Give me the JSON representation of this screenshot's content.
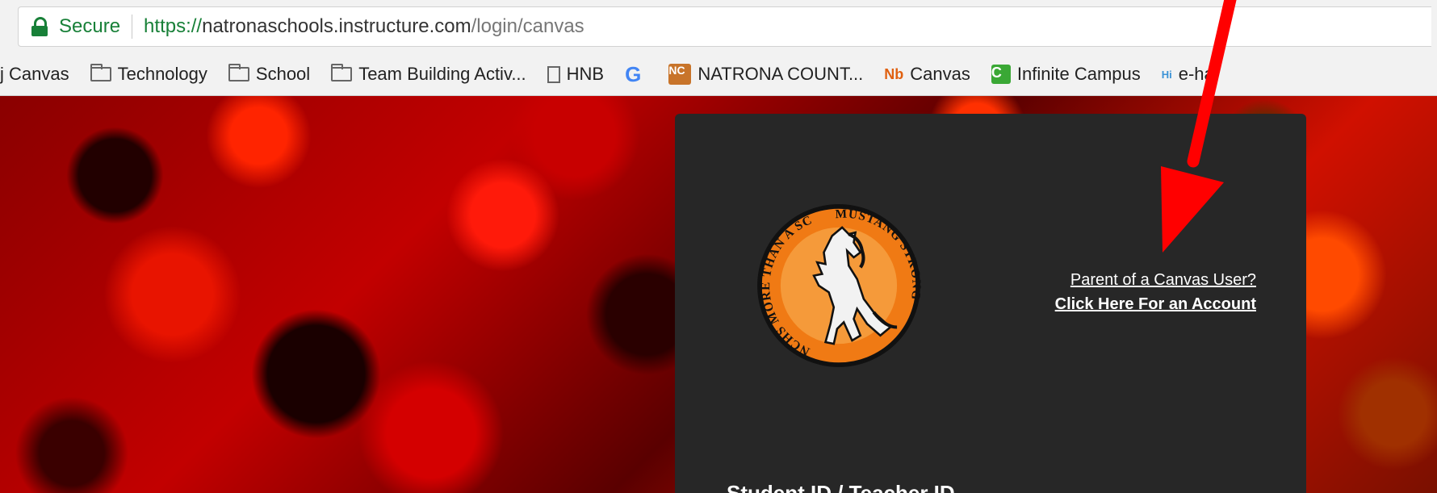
{
  "browser": {
    "secure_label": "Secure",
    "url_scheme": "https://",
    "url_host": "natronaschools.instructure.com",
    "url_path": "/login/canvas"
  },
  "bookmarks": [
    {
      "label": "j Canvas",
      "icon": "none"
    },
    {
      "label": "Technology",
      "icon": "folder-icon"
    },
    {
      "label": "School",
      "icon": "folder-icon"
    },
    {
      "label": "Team Building Activ...",
      "icon": "folder-icon"
    },
    {
      "label": "HNB",
      "icon": "page-icon"
    },
    {
      "label": "",
      "icon": "google-icon"
    },
    {
      "label": "NATRONA COUNT...",
      "icon": "natrona-logo-icon"
    },
    {
      "label": "Canvas",
      "icon": "ncsd-logo-icon"
    },
    {
      "label": "Infinite Campus",
      "icon": "infinite-campus-icon"
    },
    {
      "label": "e-hal",
      "icon": "e-hallpass-icon"
    }
  ],
  "icon_text": {
    "google": "G",
    "natrona": "NC",
    "ncsd": "Nb",
    "infinite_campus": "C",
    "ehallpass": "Hi"
  },
  "logo_text": {
    "left_arc": "NCHS MORE THAN A SCHOOL",
    "right_arc": "MUSTANG STRONG"
  },
  "login": {
    "parent_question": "Parent of a Canvas User?",
    "parent_link": "Click Here For an Account",
    "id_label": "Student ID / Teacher ID"
  },
  "colors": {
    "secure_green": "#188038",
    "panel_bg": "#272727",
    "logo_orange": "#f07a14",
    "arrow_red": "#ff0000"
  }
}
